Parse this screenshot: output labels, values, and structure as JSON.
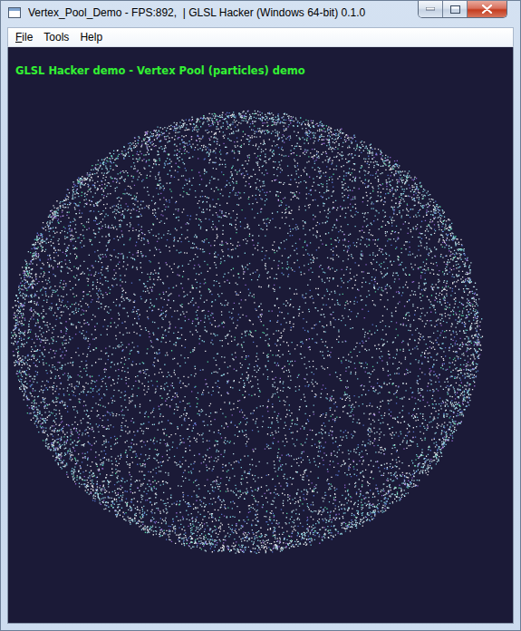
{
  "window": {
    "title": "Vertex_Pool_Demo - FPS:892,  | GLSL Hacker (Windows 64-bit) 0.1.0"
  },
  "menu": [
    {
      "label": "File",
      "mnemonic_underlined": true
    },
    {
      "label": "Tools",
      "mnemonic_underlined": false
    },
    {
      "label": "Help",
      "mnemonic_underlined": false
    }
  ],
  "viewport": {
    "overlay_text": "GLSL Hacker demo - Vertex Pool (particles) demo"
  }
}
